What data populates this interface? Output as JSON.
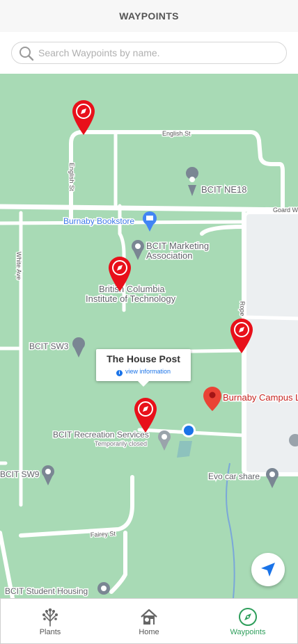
{
  "header": {
    "title": "WAYPOINTS"
  },
  "search": {
    "placeholder": "Search Waypoints by name.",
    "value": ""
  },
  "map": {
    "streets": {
      "english_st_h": "English St",
      "english_st_v": "English St",
      "goard_way": "Goard W",
      "white_ave": "White Ave",
      "fairey_st": "Fairey St",
      "rope": "Rope"
    },
    "places": {
      "bcit_ne18": "BCIT NE18",
      "burnaby_bookstore": "Burnaby Bookstore",
      "bcit_marketing_1": "BCIT Marketing",
      "bcit_marketing_2": "Association",
      "bcit_main_1": "British Columbia",
      "bcit_main_2": "Institute of Technology",
      "bcit_sw3": "BCIT SW3",
      "burnaby_campus": "Burnaby Campus L",
      "bcit_rec": "BCIT Recreation Services",
      "temp_closed": "Temporarily closed",
      "bcit_sw9": "BCIT SW9",
      "evo_car_share": "Evo car share",
      "bcit_student_housing": "BCIT Student Housing"
    },
    "callout": {
      "title": "The House Post",
      "link": "view information"
    }
  },
  "tabs": [
    {
      "label": "Plants",
      "icon": "tree-icon",
      "active": false
    },
    {
      "label": "Home",
      "icon": "home-icon",
      "active": false
    },
    {
      "label": "Waypoints",
      "icon": "compass-icon",
      "active": true
    }
  ],
  "colors": {
    "accent": "#2e9e5b",
    "map_green": "#a8dab5",
    "pin_red": "#e8101a",
    "link_blue": "#1a73e8"
  }
}
